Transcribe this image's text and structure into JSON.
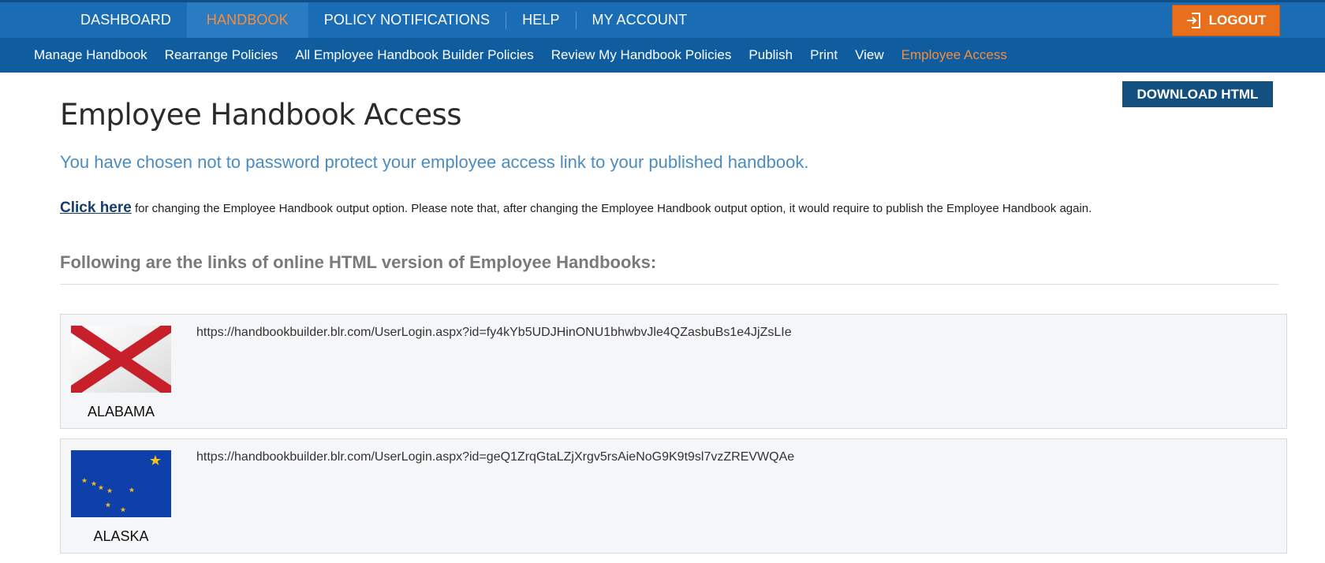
{
  "top_nav": {
    "items": [
      "DASHBOARD",
      "HANDBOOK",
      "POLICY NOTIFICATIONS",
      "HELP",
      "MY ACCOUNT"
    ],
    "active": "HANDBOOK",
    "logout_label": "LOGOUT",
    "logout_icon": "logout-icon"
  },
  "sub_nav": {
    "items": [
      "Manage Handbook",
      "Rearrange Policies",
      "All Employee Handbook Builder Policies",
      "Review My Handbook Policies",
      "Publish",
      "Print",
      "View",
      "Employee Access"
    ],
    "active": "Employee Access"
  },
  "page": {
    "download_label": "DOWNLOAD HTML",
    "title": "Employee Handbook Access",
    "notice": "You have chosen not to password protect your employee access link to your published handbook.",
    "click_here": "Click here",
    "click_text": " for changing the Employee Handbook output option. Please note that, after changing the Employee Handbook output option, it would require to publish the Employee Handbook again.",
    "links_heading": "Following are the links of online HTML version of Employee Handbooks:"
  },
  "handbooks": [
    {
      "state": "ALABAMA",
      "url": "https://handbookbuilder.blr.com/UserLogin.aspx?id=fy4kYb5UDJHinONU1bhwbvJle4QZasbuBs1e4JjZsLIe",
      "flag_icon": "alabama-flag"
    },
    {
      "state": "ALASKA",
      "url": "https://handbookbuilder.blr.com/UserLogin.aspx?id=geQ1ZrqGtaLZjXrgv5rsAieNoG9K9t9sl7vzZREVWQAe",
      "flag_icon": "alaska-flag"
    }
  ],
  "colors": {
    "nav_blue": "#1a6db5",
    "subnav_blue": "#0f5c9f",
    "accent_orange": "#f58d3c",
    "logout_orange": "#e8701c",
    "download_navy": "#14507f",
    "notice_blue": "#4b8dc2"
  }
}
